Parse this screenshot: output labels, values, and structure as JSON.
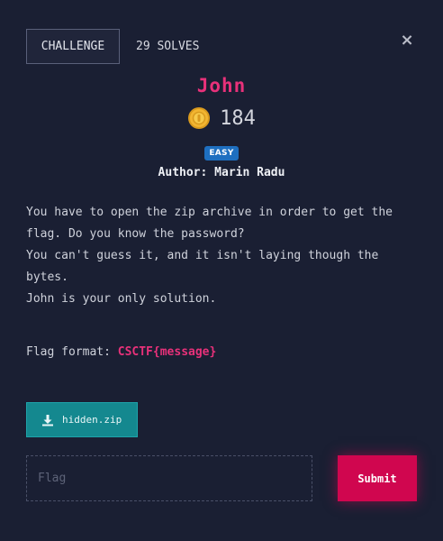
{
  "header": {
    "tab_label": "CHALLENGE",
    "solves_label": "29 SOLVES",
    "close_symbol": "×"
  },
  "challenge": {
    "title": "John",
    "points": "184",
    "difficulty": "EASY",
    "author": "Author: Marin Radu",
    "description": [
      "You have to open the zip archive in order to get the flag. Do you know the password?",
      "You can't guess it, and it isn't laying though the bytes.",
      "John is your only solution."
    ],
    "flag_format_label": "Flag format: ",
    "flag_format_value": "CSCTF{message}"
  },
  "files": {
    "download_label": "hidden.zip",
    "icon": "download-icon"
  },
  "form": {
    "flag_placeholder": "Flag",
    "flag_value": "",
    "submit_label": "Submit"
  },
  "colors": {
    "background": "#1a1f33",
    "accent_pink": "#e8317a",
    "submit": "#d0064f",
    "download": "#14888f",
    "badge": "#1e6fc0",
    "coin": "#f2b531"
  }
}
